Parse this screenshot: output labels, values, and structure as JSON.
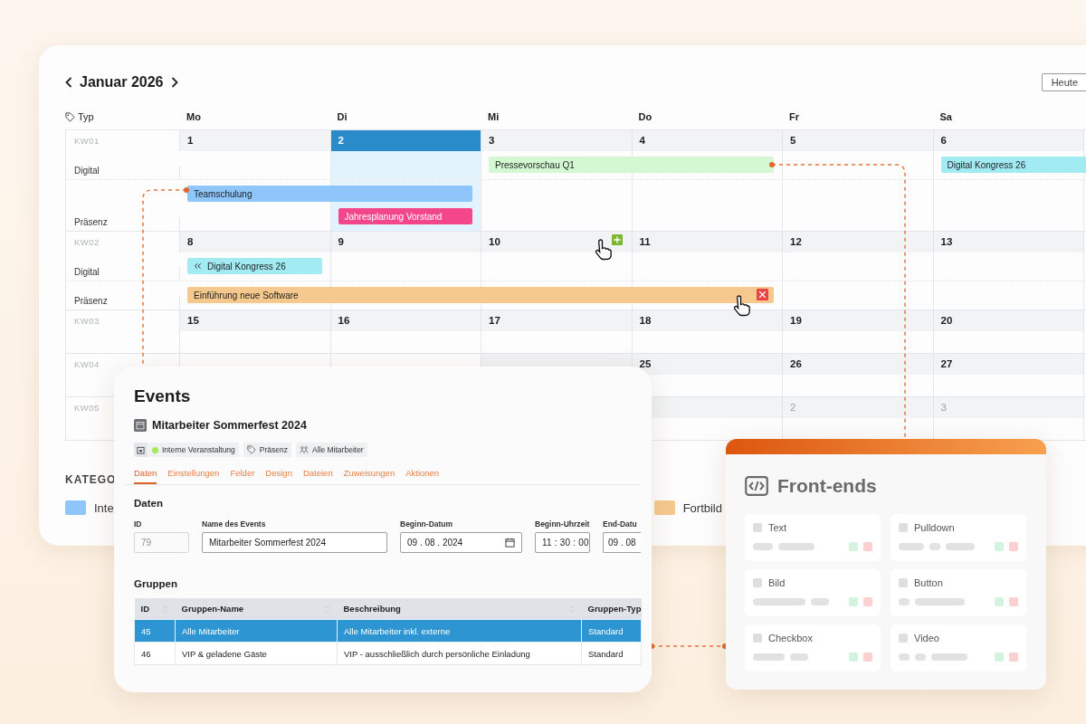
{
  "calendar": {
    "title": "Januar 2026",
    "today_button": "Heute",
    "type_header": "Typ",
    "weekdays": [
      "Mo",
      "Di",
      "Mi",
      "Do",
      "Fr",
      "Sa"
    ],
    "weeks": [
      {
        "label": "KW01",
        "days": [
          {
            "number": "1",
            "selected": false,
            "other_month": false
          },
          {
            "number": "2",
            "selected": true,
            "other_month": false
          },
          {
            "number": "3",
            "selected": false,
            "other_month": false
          },
          {
            "number": "4",
            "selected": false,
            "other_month": false
          },
          {
            "number": "5",
            "selected": false,
            "other_month": false
          },
          {
            "number": "6",
            "selected": false,
            "other_month": false
          }
        ],
        "lanes": [
          {
            "name": "Digital",
            "events": [
              {
                "title": "Pressevorschau Q1",
                "color": "#d4f8d1",
                "kind": "plain"
              },
              {
                "title": "Digital Kongress 26",
                "color": "#a2ebf3",
                "kind": "plain"
              }
            ]
          },
          {
            "name": "Präsenz",
            "events": [
              {
                "title": "Teamschulung",
                "color": "#8ec5fa",
                "kind": "plain"
              },
              {
                "title": "Jahresplanung Vorstand",
                "color": "#f4468a",
                "kind": "plain"
              }
            ]
          }
        ]
      },
      {
        "label": "KW02",
        "days": [
          {
            "number": "8",
            "selected": false,
            "other_month": false
          },
          {
            "number": "9",
            "selected": false,
            "other_month": false
          },
          {
            "number": "10",
            "selected": false,
            "other_month": false
          },
          {
            "number": "11",
            "selected": false,
            "other_month": false
          },
          {
            "number": "12",
            "selected": false,
            "other_month": false
          },
          {
            "number": "13",
            "selected": false,
            "other_month": false
          }
        ],
        "lanes": [
          {
            "name": "Digital",
            "events": [
              {
                "title": "Digital Kongress 26",
                "color": "#a2ebf3",
                "kind": "continued"
              }
            ]
          },
          {
            "name": "Präsenz",
            "events": [
              {
                "title": "Einführung neue Software",
                "color": "#f5c98e",
                "kind": "removable"
              }
            ]
          }
        ]
      },
      {
        "label": "KW03",
        "days": [
          {
            "number": "15",
            "selected": false,
            "other_month": false
          },
          {
            "number": "16",
            "selected": false,
            "other_month": false
          },
          {
            "number": "17",
            "selected": false,
            "other_month": false
          },
          {
            "number": "18",
            "selected": false,
            "other_month": false
          },
          {
            "number": "19",
            "selected": false,
            "other_month": false
          },
          {
            "number": "20",
            "selected": false,
            "other_month": false
          }
        ]
      },
      {
        "label": "KW04",
        "days": [
          {
            "number": "25",
            "selected": false,
            "other_month": false
          },
          {
            "number": "26",
            "selected": false,
            "other_month": false
          },
          {
            "number": "27",
            "selected": false,
            "other_month": false
          }
        ]
      },
      {
        "label": "KW05",
        "days": [
          {
            "number": "2",
            "selected": false,
            "other_month": true
          },
          {
            "number": "3",
            "selected": false,
            "other_month": true
          }
        ]
      }
    ],
    "legend": {
      "heading": "KATEGO",
      "items": [
        {
          "label": "Inte",
          "color": "#8ec5fa"
        },
        {
          "label": "Fortbild",
          "color": "#f5c98e"
        }
      ]
    }
  },
  "events_panel": {
    "title": "Events",
    "event_name": "Mitarbeiter Sommerfest 2024",
    "chips": [
      {
        "kind": "category",
        "label": "Interne Veranstaltung",
        "color": "#a6e85a"
      },
      {
        "kind": "tag",
        "label": "Präsenz"
      },
      {
        "kind": "audience",
        "label": "Alle Mitarbeiter"
      }
    ],
    "tabs": [
      {
        "label": "Daten",
        "selected": true
      },
      {
        "label": "Einstellungen",
        "selected": false
      },
      {
        "label": "Felder",
        "selected": false
      },
      {
        "label": "Design",
        "selected": false
      },
      {
        "label": "Dateien",
        "selected": false
      },
      {
        "label": "Zuweisungen",
        "selected": false
      },
      {
        "label": "Aktionen",
        "selected": false
      }
    ],
    "section": "Daten",
    "fields": [
      {
        "label": "ID",
        "value": "79",
        "kind": "text",
        "disabled": true
      },
      {
        "label": "Name des Events",
        "value": "Mitarbeiter Sommerfest 2024",
        "kind": "text",
        "disabled": false
      },
      {
        "label": "Beginn-Datum",
        "value": "09 . 08 . 2024",
        "kind": "date",
        "disabled": false
      },
      {
        "label": "Beginn-Uhrzeit",
        "value": "11 : 30 : 00",
        "kind": "time",
        "disabled": false
      },
      {
        "label": "End-Datu",
        "value": "09 . 08",
        "kind": "cut",
        "disabled": false
      }
    ],
    "groups_heading": "Gruppen",
    "table": {
      "columns": [
        {
          "label": "ID",
          "sortable": true
        },
        {
          "label": "Gruppen-Name",
          "sortable": true
        },
        {
          "label": "Beschreibung",
          "sortable": true
        },
        {
          "label": "Gruppen-Typ"
        }
      ],
      "rows": [
        {
          "cells": [
            "45",
            "Alle Mitarbeiter",
            "Alle Mitarbeiter inkl. externe",
            "Standard"
          ],
          "selected": true
        },
        {
          "cells": [
            "46",
            "VIP & geladene Gäste",
            "VIP - ausschließlich durch persönliche Einladung",
            "Standard"
          ],
          "selected": false
        }
      ]
    }
  },
  "frontends_panel": {
    "title": "Front-ends",
    "items": [
      {
        "label": "Text",
        "checked": false
      },
      {
        "label": "Pulldown",
        "checked": false
      },
      {
        "label": "Bild",
        "checked": false
      },
      {
        "label": "Button",
        "checked": false
      },
      {
        "label": "Checkbox",
        "checked": false
      },
      {
        "label": "Video",
        "checked": false
      }
    ]
  }
}
